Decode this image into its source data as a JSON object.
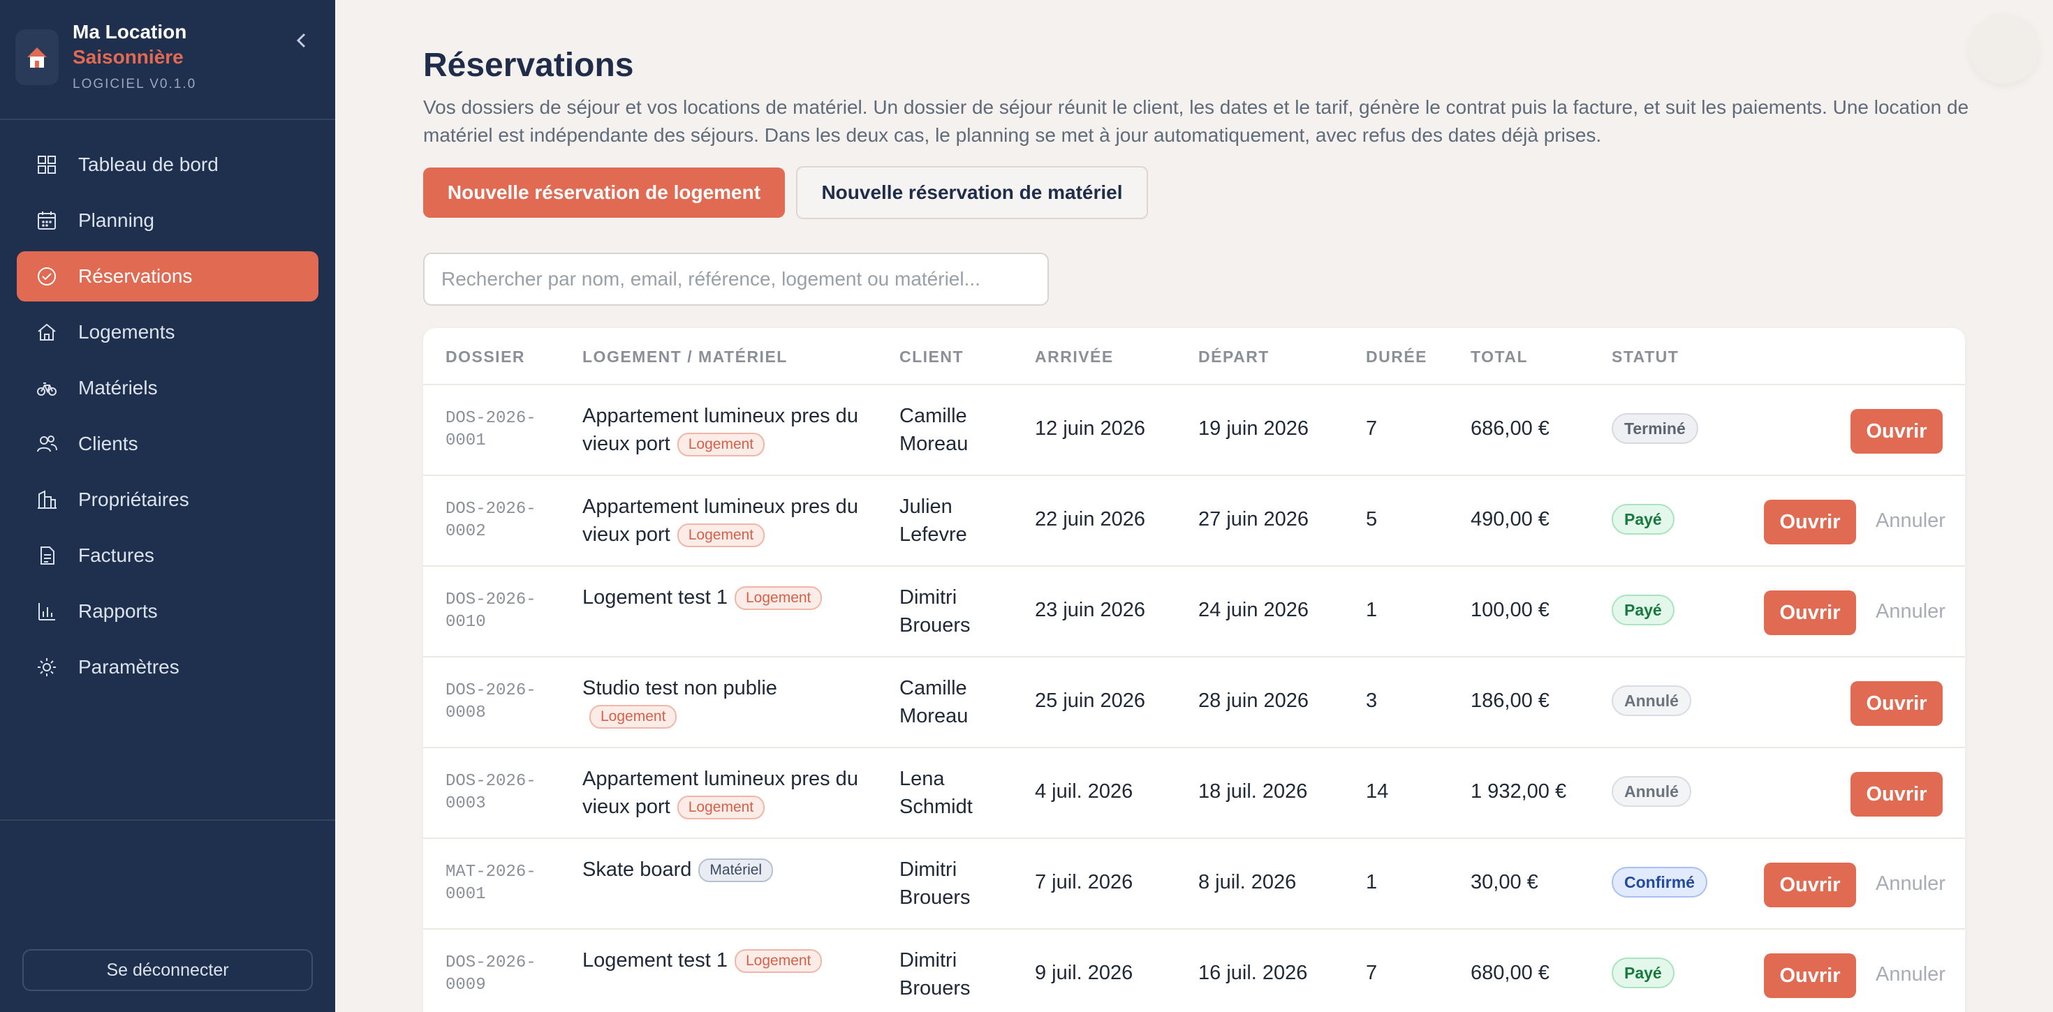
{
  "brand": {
    "name_line1": "Ma Location",
    "name_line2": "Saisonnière",
    "version": "LOGICIEL V0.1.0",
    "accent": "#e06a52"
  },
  "sidebar": {
    "items": [
      {
        "label": "Tableau de bord",
        "icon": "grid-icon",
        "active": false
      },
      {
        "label": "Planning",
        "icon": "calendar-icon",
        "active": false
      },
      {
        "label": "Réservations",
        "icon": "check-circle-icon",
        "active": true
      },
      {
        "label": "Logements",
        "icon": "home-icon",
        "active": false
      },
      {
        "label": "Matériels",
        "icon": "bike-icon",
        "active": false
      },
      {
        "label": "Clients",
        "icon": "users-icon",
        "active": false
      },
      {
        "label": "Propriétaires",
        "icon": "building-icon",
        "active": false
      },
      {
        "label": "Factures",
        "icon": "file-icon",
        "active": false
      },
      {
        "label": "Rapports",
        "icon": "bar-chart-icon",
        "active": false
      },
      {
        "label": "Paramètres",
        "icon": "sun-icon",
        "active": false
      }
    ],
    "logout_label": "Se déconnecter"
  },
  "page": {
    "title": "Réservations",
    "description": "Vos dossiers de séjour et vos locations de matériel. Un dossier de séjour réunit le client, les dates et le tarif, génère le contrat puis la facture, et suit les paiements. Une location de matériel est indépendante des séjours. Dans les deux cas, le planning se met à jour automatiquement, avec refus des dates déjà prises.",
    "new_lodging_label": "Nouvelle réservation de logement",
    "new_material_label": "Nouvelle réservation de matériel",
    "search_placeholder": "Rechercher par nom, email, référence, logement ou matériel..."
  },
  "table": {
    "headers": {
      "dossier": "DOSSIER",
      "item": "LOGEMENT / MATÉRIEL",
      "client": "CLIENT",
      "arrival": "ARRIVÉE",
      "departure": "DÉPART",
      "duration": "DURÉE",
      "total": "TOTAL",
      "status": "STATUT"
    },
    "open_label": "Ouvrir",
    "cancel_label": "Annuler",
    "rows": [
      {
        "ref1": "DOS-2026-",
        "ref2": "0001",
        "item": "Appartement lumineux pres du vieux port",
        "tag": "Logement",
        "tag_type": "logement",
        "client": "Camille Moreau",
        "arrival": "12 juin 2026",
        "departure": "19 juin 2026",
        "duration": "7",
        "total": "686,00 €",
        "status": "Terminé",
        "status_type": "termine",
        "cancel": false
      },
      {
        "ref1": "DOS-2026-",
        "ref2": "0002",
        "item": "Appartement lumineux pres du vieux port",
        "tag": "Logement",
        "tag_type": "logement",
        "client": "Julien Lefevre",
        "arrival": "22 juin 2026",
        "departure": "27 juin 2026",
        "duration": "5",
        "total": "490,00 €",
        "status": "Payé",
        "status_type": "paye",
        "cancel": true
      },
      {
        "ref1": "DOS-2026-",
        "ref2": "0010",
        "item": "Logement test 1",
        "tag": "Logement",
        "tag_type": "logement",
        "client": "Dimitri Brouers",
        "arrival": "23 juin 2026",
        "departure": "24 juin 2026",
        "duration": "1",
        "total": "100,00 €",
        "status": "Payé",
        "status_type": "paye",
        "cancel": true
      },
      {
        "ref1": "DOS-2026-",
        "ref2": "0008",
        "item": "Studio test non publie",
        "tag": "Logement",
        "tag_type": "logement",
        "client": "Camille Moreau",
        "arrival": "25 juin 2026",
        "departure": "28 juin 2026",
        "duration": "3",
        "total": "186,00 €",
        "status": "Annulé",
        "status_type": "annule",
        "cancel": false
      },
      {
        "ref1": "DOS-2026-",
        "ref2": "0003",
        "item": "Appartement lumineux pres du vieux port",
        "tag": "Logement",
        "tag_type": "logement",
        "client": "Lena Schmidt",
        "arrival": "4 juil. 2026",
        "departure": "18 juil. 2026",
        "duration": "14",
        "total": "1 932,00 €",
        "status": "Annulé",
        "status_type": "annule",
        "cancel": false
      },
      {
        "ref1": "MAT-2026-",
        "ref2": "0001",
        "item": "Skate board",
        "tag": "Matériel",
        "tag_type": "materiel",
        "client": "Dimitri Brouers",
        "arrival": "7 juil. 2026",
        "departure": "8 juil. 2026",
        "duration": "1",
        "total": "30,00 €",
        "status": "Confirmé",
        "status_type": "confirme",
        "cancel": true
      },
      {
        "ref1": "DOS-2026-",
        "ref2": "0009",
        "item": "Logement test 1",
        "tag": "Logement",
        "tag_type": "logement",
        "client": "Dimitri Brouers",
        "arrival": "9 juil. 2026",
        "departure": "16 juil. 2026",
        "duration": "7",
        "total": "680,00 €",
        "status": "Payé",
        "status_type": "paye",
        "cancel": true
      }
    ]
  }
}
